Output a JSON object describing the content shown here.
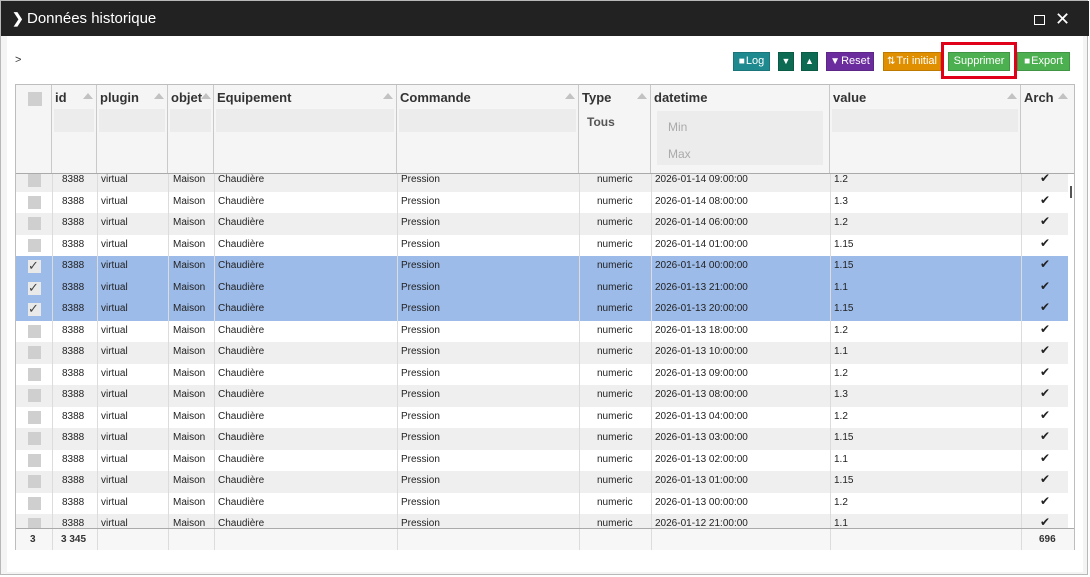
{
  "window": {
    "title": "Données historique"
  },
  "breadcrumb": ">",
  "toolbar": {
    "log": "Log",
    "reset": "Reset",
    "tri": "Tri initial",
    "supprimer": "Supprimer",
    "export": "Export"
  },
  "colors": {
    "log": "#1e8a8f",
    "expand": "#0c6b52",
    "reset": "#6b2d9d",
    "tri": "#e08f00",
    "supprimer": "#4caf50",
    "export": "#4caf50",
    "selected_row": "#9dbbe8",
    "highlight": "#e1001a"
  },
  "columns": [
    "id",
    "plugin",
    "objet",
    "Equipement",
    "Commande",
    "Type",
    "datetime",
    "value",
    "Arch"
  ],
  "filters": {
    "type": "Tous",
    "min": "Min",
    "max": "Max"
  },
  "rows": [
    {
      "id": "8388",
      "plugin": "virtual",
      "objet": "Maison",
      "equipement": "Chaudière",
      "commande": "Pression",
      "type": "numeric",
      "datetime": "2026-01-14 09:00:00",
      "value": "1.2",
      "selected": false
    },
    {
      "id": "8388",
      "plugin": "virtual",
      "objet": "Maison",
      "equipement": "Chaudière",
      "commande": "Pression",
      "type": "numeric",
      "datetime": "2026-01-14 08:00:00",
      "value": "1.3",
      "selected": false
    },
    {
      "id": "8388",
      "plugin": "virtual",
      "objet": "Maison",
      "equipement": "Chaudière",
      "commande": "Pression",
      "type": "numeric",
      "datetime": "2026-01-14 06:00:00",
      "value": "1.2",
      "selected": false
    },
    {
      "id": "8388",
      "plugin": "virtual",
      "objet": "Maison",
      "equipement": "Chaudière",
      "commande": "Pression",
      "type": "numeric",
      "datetime": "2026-01-14 01:00:00",
      "value": "1.15",
      "selected": false
    },
    {
      "id": "8388",
      "plugin": "virtual",
      "objet": "Maison",
      "equipement": "Chaudière",
      "commande": "Pression",
      "type": "numeric",
      "datetime": "2026-01-14 00:00:00",
      "value": "1.15",
      "selected": true
    },
    {
      "id": "8388",
      "plugin": "virtual",
      "objet": "Maison",
      "equipement": "Chaudière",
      "commande": "Pression",
      "type": "numeric",
      "datetime": "2026-01-13 21:00:00",
      "value": "1.1",
      "selected": true
    },
    {
      "id": "8388",
      "plugin": "virtual",
      "objet": "Maison",
      "equipement": "Chaudière",
      "commande": "Pression",
      "type": "numeric",
      "datetime": "2026-01-13 20:00:00",
      "value": "1.15",
      "selected": true
    },
    {
      "id": "8388",
      "plugin": "virtual",
      "objet": "Maison",
      "equipement": "Chaudière",
      "commande": "Pression",
      "type": "numeric",
      "datetime": "2026-01-13 18:00:00",
      "value": "1.2",
      "selected": false
    },
    {
      "id": "8388",
      "plugin": "virtual",
      "objet": "Maison",
      "equipement": "Chaudière",
      "commande": "Pression",
      "type": "numeric",
      "datetime": "2026-01-13 10:00:00",
      "value": "1.1",
      "selected": false
    },
    {
      "id": "8388",
      "plugin": "virtual",
      "objet": "Maison",
      "equipement": "Chaudière",
      "commande": "Pression",
      "type": "numeric",
      "datetime": "2026-01-13 09:00:00",
      "value": "1.2",
      "selected": false
    },
    {
      "id": "8388",
      "plugin": "virtual",
      "objet": "Maison",
      "equipement": "Chaudière",
      "commande": "Pression",
      "type": "numeric",
      "datetime": "2026-01-13 08:00:00",
      "value": "1.3",
      "selected": false
    },
    {
      "id": "8388",
      "plugin": "virtual",
      "objet": "Maison",
      "equipement": "Chaudière",
      "commande": "Pression",
      "type": "numeric",
      "datetime": "2026-01-13 04:00:00",
      "value": "1.2",
      "selected": false
    },
    {
      "id": "8388",
      "plugin": "virtual",
      "objet": "Maison",
      "equipement": "Chaudière",
      "commande": "Pression",
      "type": "numeric",
      "datetime": "2026-01-13 03:00:00",
      "value": "1.15",
      "selected": false
    },
    {
      "id": "8388",
      "plugin": "virtual",
      "objet": "Maison",
      "equipement": "Chaudière",
      "commande": "Pression",
      "type": "numeric",
      "datetime": "2026-01-13 02:00:00",
      "value": "1.1",
      "selected": false
    },
    {
      "id": "8388",
      "plugin": "virtual",
      "objet": "Maison",
      "equipement": "Chaudière",
      "commande": "Pression",
      "type": "numeric",
      "datetime": "2026-01-13 01:00:00",
      "value": "1.15",
      "selected": false
    },
    {
      "id": "8388",
      "plugin": "virtual",
      "objet": "Maison",
      "equipement": "Chaudière",
      "commande": "Pression",
      "type": "numeric",
      "datetime": "2026-01-13 00:00:00",
      "value": "1.2",
      "selected": false
    },
    {
      "id": "8388",
      "plugin": "virtual",
      "objet": "Maison",
      "equipement": "Chaudière",
      "commande": "Pression",
      "type": "numeric",
      "datetime": "2026-01-12 21:00:00",
      "value": "1.1",
      "selected": false
    }
  ],
  "footer": {
    "selected_count": "3",
    "total_count": "3 345",
    "arch_count": "696"
  }
}
